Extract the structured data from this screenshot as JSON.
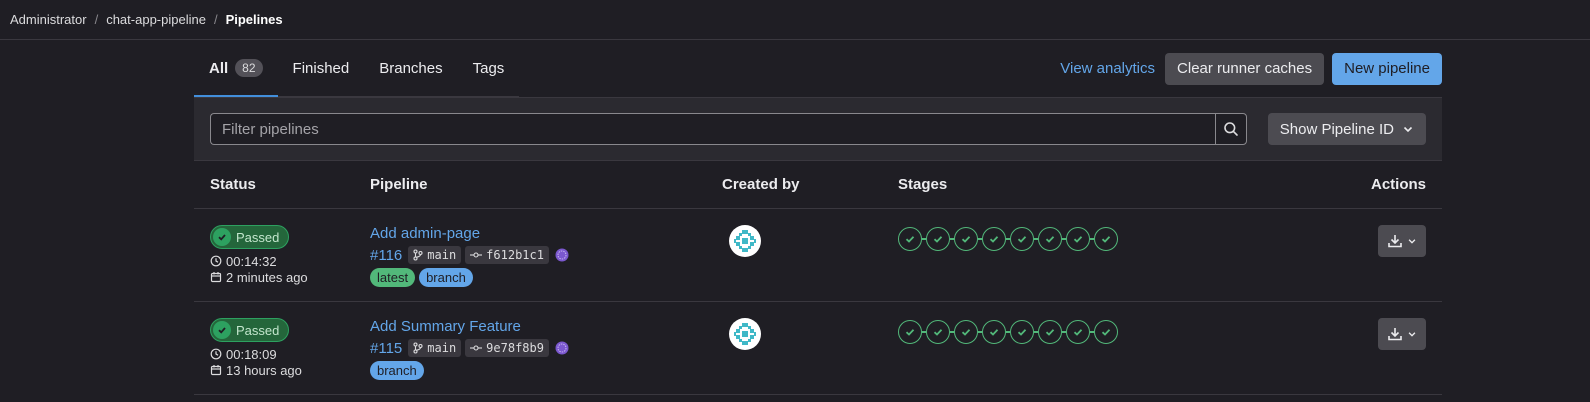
{
  "breadcrumb": [
    "Administrator",
    "chat-app-pipeline",
    "Pipelines"
  ],
  "tabs": [
    {
      "label": "All",
      "count": "82"
    },
    {
      "label": "Finished"
    },
    {
      "label": "Branches"
    },
    {
      "label": "Tags"
    }
  ],
  "toolbar": {
    "view_analytics": "View analytics",
    "clear_caches": "Clear runner caches",
    "new_pipeline": "New pipeline"
  },
  "filter": {
    "placeholder": "Filter pipelines",
    "show_id_label": "Show Pipeline ID"
  },
  "columns": {
    "status": "Status",
    "pipeline": "Pipeline",
    "created_by": "Created by",
    "stages": "Stages",
    "actions": "Actions"
  },
  "rows": [
    {
      "status": "Passed",
      "duration": "00:14:32",
      "finished": "2 minutes ago",
      "title": "Add admin-page",
      "id": "#116",
      "branch": "main",
      "commit": "f612b1c1",
      "labels": [
        "latest",
        "branch"
      ],
      "stages_passed": 8
    },
    {
      "status": "Passed",
      "duration": "00:18:09",
      "finished": "13 hours ago",
      "title": "Add Summary Feature",
      "id": "#115",
      "branch": "main",
      "commit": "9e78f8b9",
      "labels": [
        "branch"
      ],
      "stages_passed": 8
    }
  ],
  "colors": {
    "background": "#1f1e24",
    "accent_blue": "#63a6e9",
    "success_green": "#52b87a",
    "badge_green": "#24663b"
  },
  "icons": [
    "search-icon",
    "chevron-down-icon",
    "check-icon",
    "clock-icon",
    "calendar-icon",
    "branch-icon",
    "commit-icon",
    "download-icon"
  ]
}
